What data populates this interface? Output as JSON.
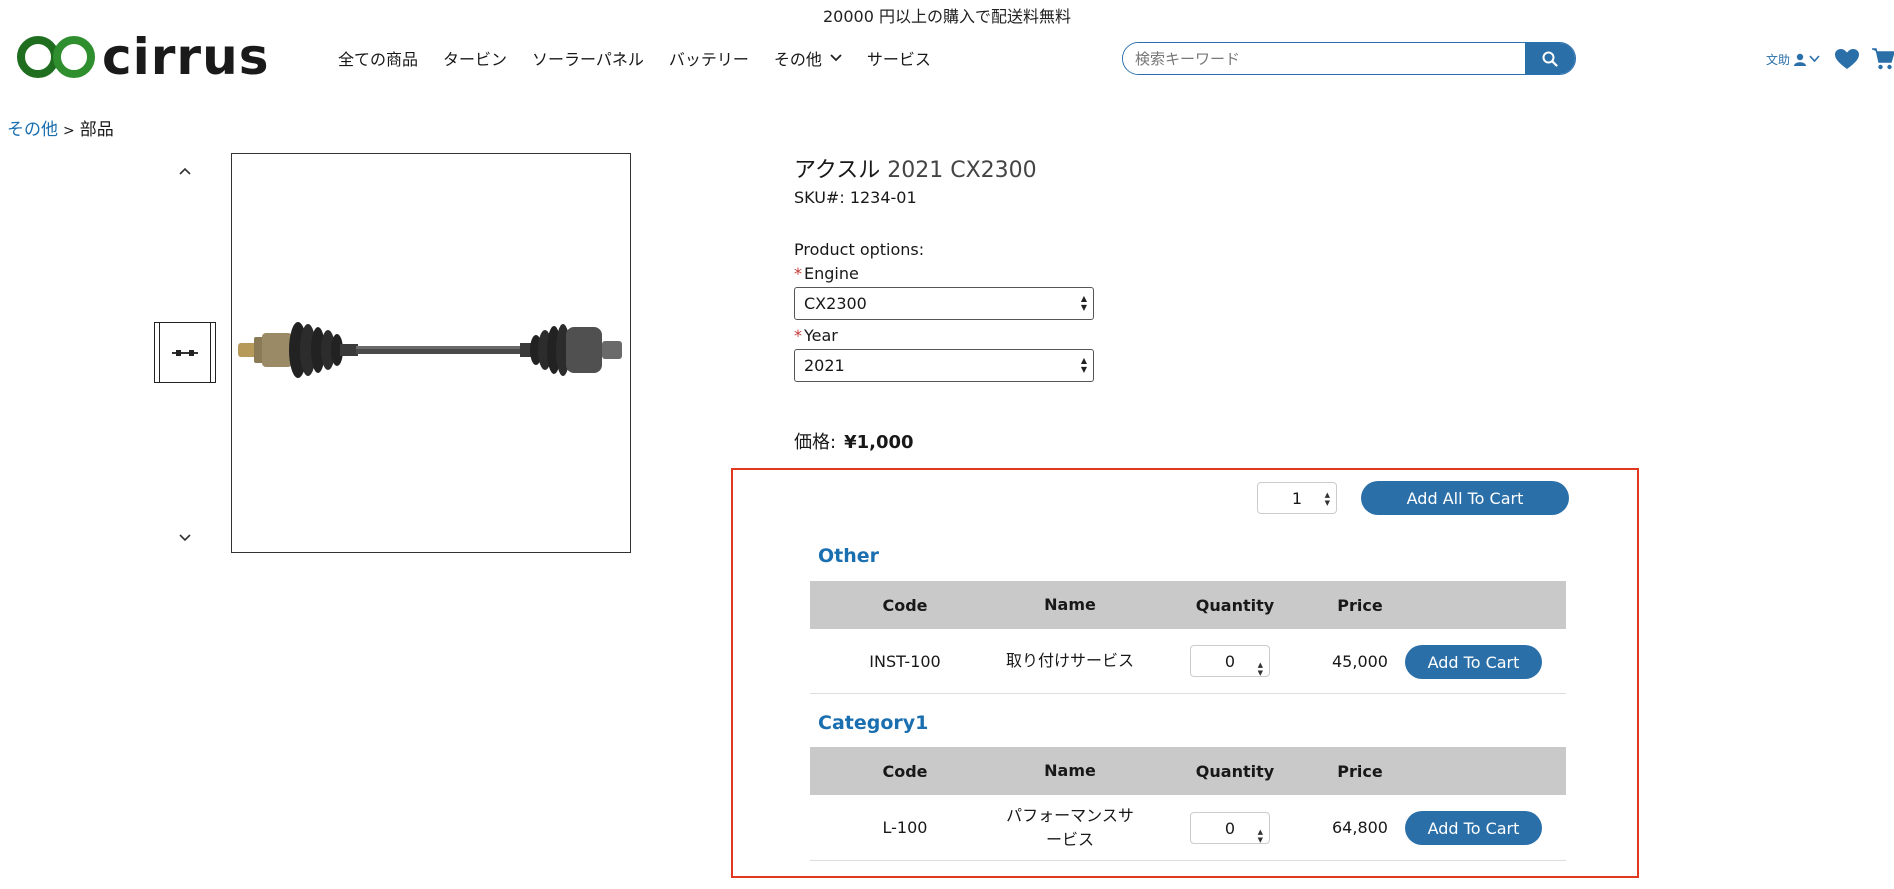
{
  "promo": "20000 円以上の購入で配送料無料",
  "logo": {
    "text": "cirrus"
  },
  "nav": {
    "items": [
      "全ての商品",
      "タービン",
      "ソーラーパネル",
      "バッテリー",
      "その他",
      "サービス"
    ]
  },
  "search": {
    "placeholder": "検索キーワード"
  },
  "user": {
    "label": "文助"
  },
  "breadcrumb": {
    "parent": "その他",
    "separator": ">",
    "current": "部品"
  },
  "product": {
    "title_prefix": "アクスル",
    "title_suffix": "2021 CX2300",
    "sku": "SKU#: 1234-01",
    "options_label": "Product options:",
    "engine_label": "Engine",
    "engine_value": "CX2300",
    "year_label": "Year",
    "year_value": "2021",
    "price_label": "価格:",
    "price_value": "¥1,000"
  },
  "bundle": {
    "quantity": "1",
    "add_all_label": "Add All To Cart",
    "columns": {
      "code": "Code",
      "name": "Name",
      "quantity": "Quantity",
      "price": "Price"
    },
    "sections": [
      {
        "title": "Other",
        "rows": [
          {
            "code": "INST-100",
            "name": "取り付けサービス",
            "quantity": "0",
            "price": "45,000",
            "button": "Add To Cart"
          }
        ]
      },
      {
        "title": "Category1",
        "rows": [
          {
            "code": "L-100",
            "name": "パフォーマンスサービス",
            "quantity": "0",
            "price": "64,800",
            "button": "Add To Cart"
          }
        ]
      }
    ]
  },
  "colors": {
    "brand_blue": "#2a6fa8",
    "link_blue": "#1a6fb0",
    "logo_green": "#1f6e1f",
    "highlight_red": "#e0391f"
  }
}
